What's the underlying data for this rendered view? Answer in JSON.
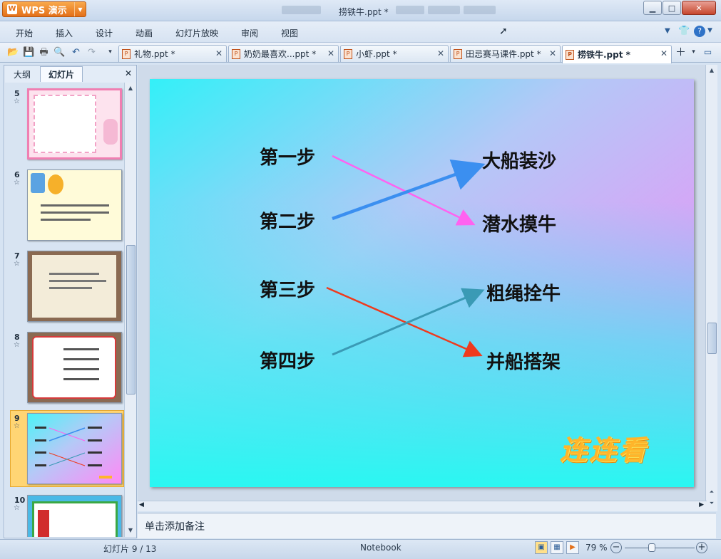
{
  "app": {
    "button_label": "WPS 演示",
    "logo_glyph": "W",
    "title": "捞铁牛.ppt *"
  },
  "window_controls": {
    "minimize": "▁",
    "maximize": "□",
    "close": "✕"
  },
  "menu": {
    "items": [
      "开始",
      "插入",
      "设计",
      "动画",
      "幻灯片放映",
      "审阅",
      "视图"
    ],
    "right_icons": [
      "chevron-down",
      "shirt",
      "help"
    ]
  },
  "tabs": [
    {
      "label": "礼物.ppt *",
      "active": false
    },
    {
      "label": "奶奶最喜欢...ppt *",
      "active": false
    },
    {
      "label": "小虾.ppt *",
      "active": false
    },
    {
      "label": "田忌赛马课件.ppt *",
      "active": false
    },
    {
      "label": "捞铁牛.ppt *",
      "active": true
    }
  ],
  "left_panel": {
    "tabs": [
      "大纲",
      "幻灯片"
    ],
    "active_tab": "幻灯片",
    "close": "✕",
    "thumbnails": [
      {
        "number": "5",
        "kind": "pink-frame"
      },
      {
        "number": "6",
        "kind": "cream-cartoon"
      },
      {
        "number": "7",
        "kind": "notebook"
      },
      {
        "number": "8",
        "kind": "red-scroll"
      },
      {
        "number": "9",
        "kind": "current-gradient",
        "selected": true
      },
      {
        "number": "10",
        "kind": "green-border"
      }
    ]
  },
  "slide": {
    "left_steps": [
      "第一步",
      "第二步",
      "第三步",
      "第四步"
    ],
    "right_answers": [
      "大船装沙",
      "潜水摸牛",
      "粗绳拴牛",
      "并船搭架"
    ],
    "decoration": "连连看",
    "connections": [
      {
        "from": "第一步",
        "to": "潜水摸牛",
        "color": "#ff62f0"
      },
      {
        "from": "第二步",
        "to": "大船装沙",
        "color": "#3b8ff0"
      },
      {
        "from": "第三步",
        "to": "并船搭架",
        "color": "#ef3a1d"
      },
      {
        "from": "第四步",
        "to": "粗绳拴牛",
        "color": "#3a9ab5"
      }
    ]
  },
  "notes_placeholder": "单击添加备注",
  "status": {
    "slide_position": "幻灯片 9 / 13",
    "theme": "Notebook",
    "zoom": "79 %",
    "zoom_level": 0.79
  }
}
